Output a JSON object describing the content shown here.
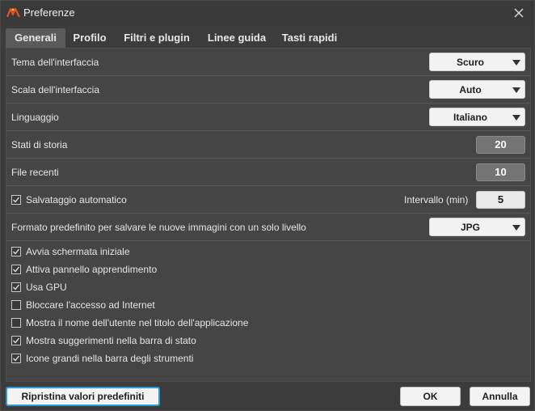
{
  "window": {
    "title": "Preferenze",
    "icon": "app-logo-icon",
    "close_icon": "close-icon"
  },
  "tabs": [
    {
      "label": "Generali",
      "active": true
    },
    {
      "label": "Profilo",
      "active": false
    },
    {
      "label": "Filtri e plugin",
      "active": false
    },
    {
      "label": "Linee guida",
      "active": false
    },
    {
      "label": "Tasti rapidi",
      "active": false
    }
  ],
  "settings": {
    "theme": {
      "label": "Tema dell'interfaccia",
      "value": "Scuro"
    },
    "scale": {
      "label": "Scala dell'interfaccia",
      "value": "Auto"
    },
    "language": {
      "label": "Linguaggio",
      "value": "Italiano"
    },
    "history": {
      "label": "Stati di storia",
      "value": "20"
    },
    "recent": {
      "label": "File recenti",
      "value": "10"
    },
    "autosave": {
      "label": "Salvataggio automatico",
      "checked": true,
      "interval_label": "Intervallo (min)",
      "interval_value": "5"
    },
    "format": {
      "label": "Formato predefinito per salvare le nuove immagini con un solo livello",
      "value": "JPG"
    }
  },
  "checkboxes": [
    {
      "label": "Avvia schermata iniziale",
      "checked": true
    },
    {
      "label": "Attiva pannello apprendimento",
      "checked": true
    },
    {
      "label": "Usa GPU",
      "checked": true
    },
    {
      "label": "Bloccare l'accesso ad Internet",
      "checked": false
    },
    {
      "label": "Mostra il nome dell'utente nel titolo dell'applicazione",
      "checked": false
    },
    {
      "label": "Mostra suggerimenti nella barra di stato",
      "checked": true
    },
    {
      "label": "Icone grandi nella barra degli strumenti",
      "checked": true
    }
  ],
  "footer": {
    "reset_label": "Ripristina valori predefiniti",
    "ok_label": "OK",
    "cancel_label": "Annulla"
  },
  "colors": {
    "accent": "#2e9ad0",
    "background": "#3c3c3c",
    "panel": "#454545"
  }
}
